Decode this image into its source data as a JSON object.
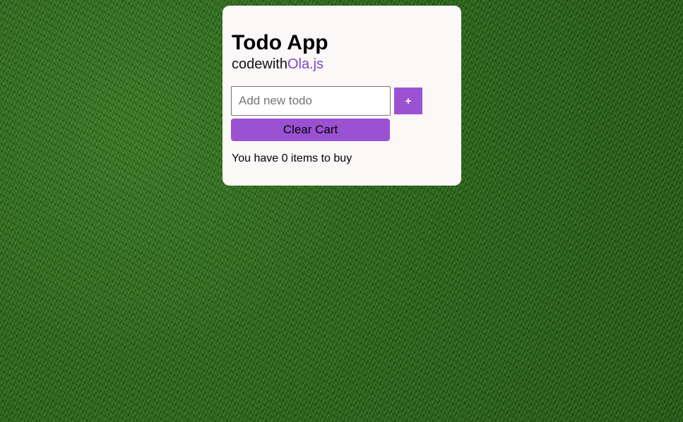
{
  "app": {
    "title": "Todo App",
    "subtitle_prefix": "codewith",
    "subtitle_accent": "Ola.js"
  },
  "form": {
    "input_placeholder": "Add new todo",
    "input_value": "",
    "add_button_label": "+",
    "clear_button_label": "Clear Cart"
  },
  "status": {
    "text": "You have 0 items to buy"
  },
  "colors": {
    "accent": "#9a52d3",
    "subtitle_accent": "#7b45c4",
    "card_background": "#fdf8f8"
  }
}
